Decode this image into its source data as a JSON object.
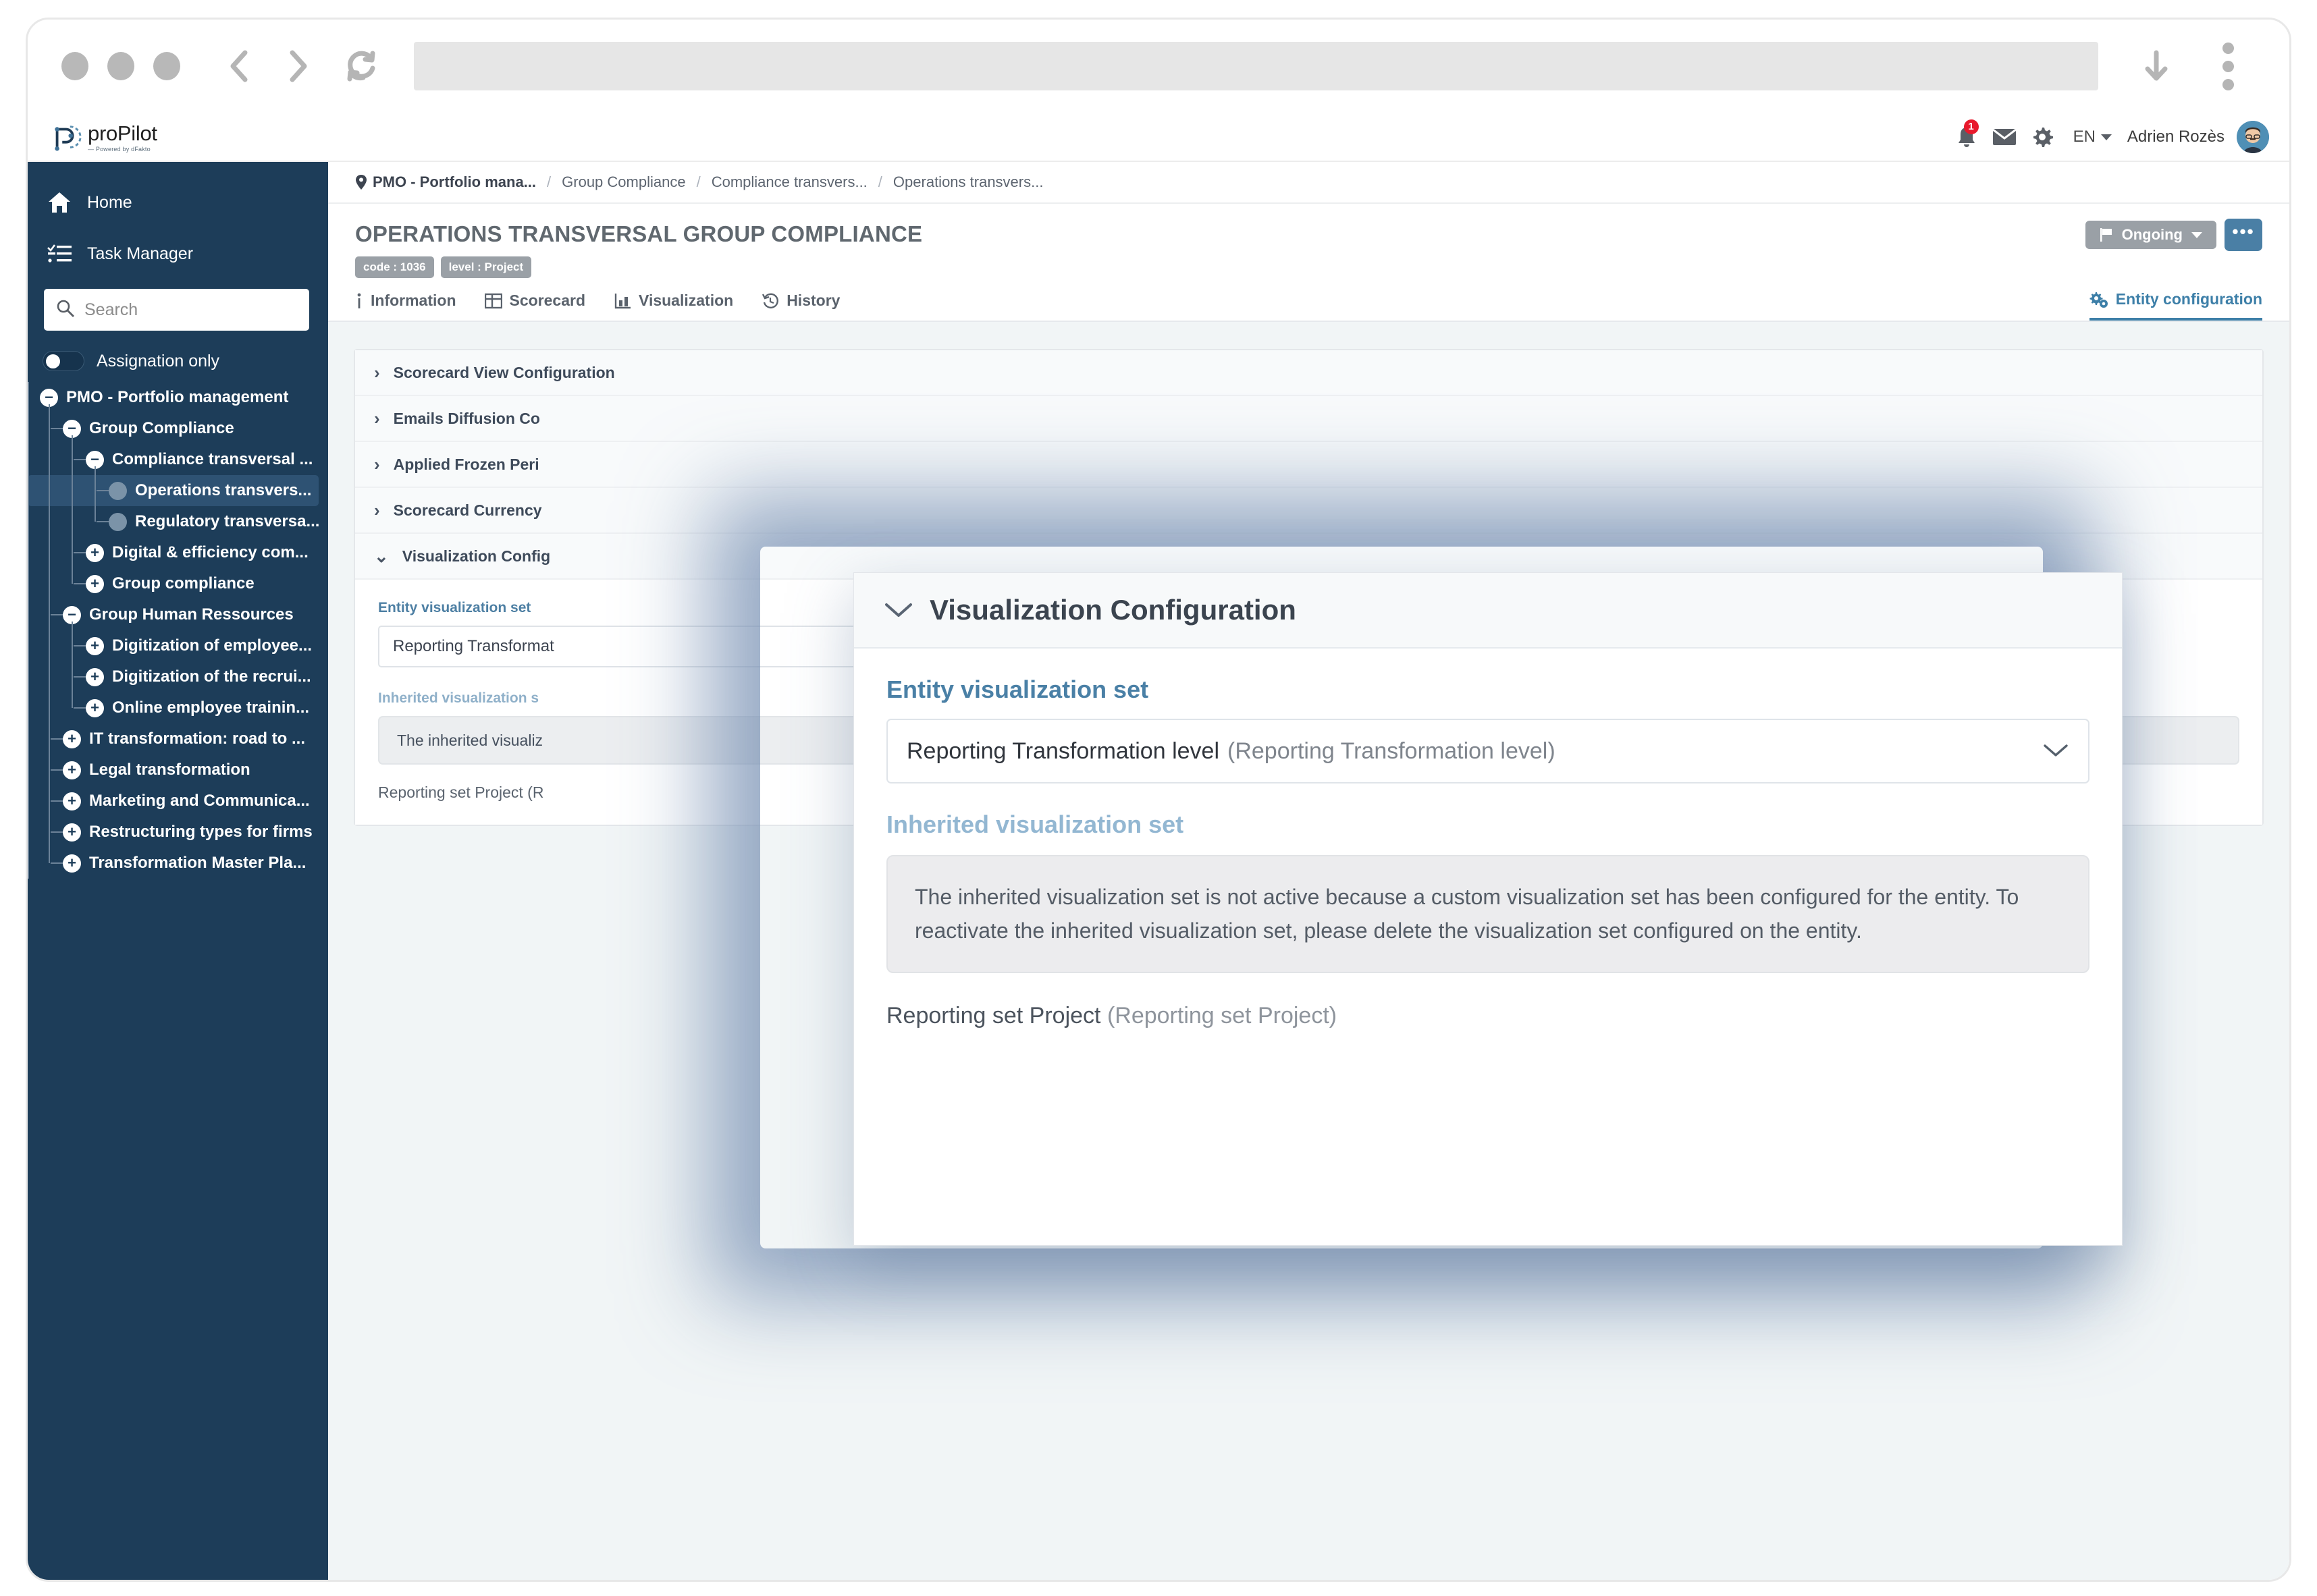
{
  "browser": {
    "url_value": "",
    "back_icon": "chevron-left-icon",
    "forward_icon": "chevron-right-icon",
    "reload_icon": "reload-icon",
    "download_icon": "download-arrow-icon",
    "menu_icon": "kebab-menu-icon"
  },
  "topbar": {
    "brand_name": "proPilot",
    "brand_tagline": "— Powered by dFakto",
    "notification_count": "1",
    "language": "EN",
    "user_name": "Adrien Rozès"
  },
  "sidebar": {
    "nav": [
      {
        "label": "Home",
        "icon": "home-icon"
      },
      {
        "label": "Task Manager",
        "icon": "task-list-icon"
      }
    ],
    "search_placeholder": "Search",
    "search_value": "",
    "assignation_label": "Assignation only",
    "tree": [
      {
        "label": "PMO - Portfolio management",
        "depth": 0,
        "state": "minus",
        "selected": false
      },
      {
        "label": "Group Compliance",
        "depth": 1,
        "state": "minus",
        "selected": false
      },
      {
        "label": "Compliance transversal ...",
        "depth": 2,
        "state": "minus",
        "selected": false
      },
      {
        "label": "Operations transvers...",
        "depth": 3,
        "state": "leaf",
        "selected": true
      },
      {
        "label": "Regulatory transversa...",
        "depth": 3,
        "state": "leaf",
        "selected": false
      },
      {
        "label": "Digital & efficiency com...",
        "depth": 2,
        "state": "plus",
        "selected": false
      },
      {
        "label": "Group compliance",
        "depth": 2,
        "state": "plus",
        "selected": false
      },
      {
        "label": "Group Human Ressources",
        "depth": 1,
        "state": "minus",
        "selected": false
      },
      {
        "label": "Digitization of employee...",
        "depth": 2,
        "state": "plus",
        "selected": false
      },
      {
        "label": "Digitization of the recrui...",
        "depth": 2,
        "state": "plus",
        "selected": false
      },
      {
        "label": "Online employee trainin...",
        "depth": 2,
        "state": "plus",
        "selected": false
      },
      {
        "label": "IT transformation: road to ...",
        "depth": 1,
        "state": "plus",
        "selected": false
      },
      {
        "label": "Legal transformation",
        "depth": 1,
        "state": "plus",
        "selected": false
      },
      {
        "label": "Marketing and Communica...",
        "depth": 1,
        "state": "plus",
        "selected": false
      },
      {
        "label": "Restructuring types for firms",
        "depth": 1,
        "state": "plus",
        "selected": false
      },
      {
        "label": "Transformation Master Pla...",
        "depth": 1,
        "state": "plus",
        "selected": false
      }
    ]
  },
  "breadcrumb": {
    "location_icon": "map-pin-icon",
    "items": [
      "PMO - Portfolio mana...",
      "Group Compliance",
      "Compliance transvers...",
      "Operations transvers..."
    ],
    "separator": "/"
  },
  "page": {
    "title": "OPERATIONS TRANSVERSAL GROUP COMPLIANCE",
    "badges": [
      "code : 1036",
      "level : Project"
    ],
    "status_label": "Ongoing",
    "status_icon": "flag-icon",
    "more_label": "•••"
  },
  "tabs": [
    {
      "label": "Information",
      "icon": "info-icon",
      "active": false
    },
    {
      "label": "Scorecard",
      "icon": "grid-icon",
      "active": false
    },
    {
      "label": "Visualization",
      "icon": "chart-icon",
      "active": false
    },
    {
      "label": "History",
      "icon": "history-icon",
      "active": false
    },
    {
      "label": "Entity configuration",
      "icon": "gears-icon",
      "active": true
    }
  ],
  "accordion": {
    "rows": [
      {
        "label": "Scorecard View Configuration",
        "expanded": false
      },
      {
        "label": "Emails Diffusion Co",
        "expanded": false
      },
      {
        "label": "Applied Frozen Peri",
        "expanded": false
      },
      {
        "label": "Scorecard Currency",
        "expanded": false
      },
      {
        "label": "Visualization Config",
        "expanded": true
      }
    ],
    "entity_set_label": "Entity visualization set",
    "entity_set_value": "Reporting Transformat",
    "inherited_set_label": "Inherited visualization s",
    "inherited_set_text": "The inherited visualiz",
    "inherited_set_text_tail": "on the entity.",
    "footline": "Reporting set Project (R"
  },
  "modal": {
    "chevron_icon": "chevron-down-icon",
    "title": "Visualization Configuration",
    "entity_set_label": "Entity visualization set",
    "entity_set_value": "Reporting Transformation level",
    "entity_set_value_alias": "(Reporting Transformation level)",
    "select_caret": "chevron-down-icon",
    "inherited_set_label": "Inherited visualization set",
    "inherited_set_message": "The inherited visualization set is not active because a custom visualization set has been configured for the entity. To reactivate the inherited visualization set, please delete the visualization set configured on the entity.",
    "footline_main": "Reporting set Project",
    "footline_alias": "(Reporting set Project)"
  },
  "colors": {
    "sidebar_bg": "#1d3d59",
    "accent_blue": "#4a80a6",
    "badge_gray": "#9aa0a6",
    "notif_red": "#e8192c",
    "page_bg": "#f1f5f6"
  }
}
